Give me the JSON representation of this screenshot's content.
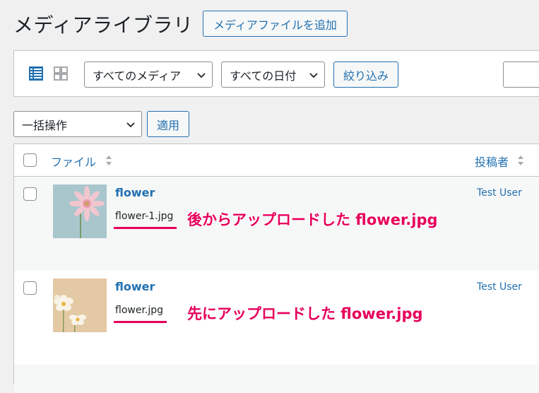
{
  "header": {
    "title": "メディアライブラリ",
    "add_button": "メディアファイルを追加"
  },
  "filters": {
    "media_type": "すべてのメディア",
    "date": "すべての日付",
    "filter_button": "絞り込み"
  },
  "bulk": {
    "action": "一括操作",
    "apply_button": "適用"
  },
  "table": {
    "columns": [
      "ファイル",
      "投稿者"
    ],
    "rows": [
      {
        "title": "flower",
        "filename": "flower-1.jpg",
        "annotation": "後からアップロードした flower.jpg",
        "author": "Test User"
      },
      {
        "title": "flower",
        "filename": "flower.jpg",
        "annotation": "先にアップロードした flower.jpg",
        "author": "Test User"
      }
    ]
  },
  "colors": {
    "accent": "#2271b1",
    "annotation": "#e6005c",
    "background": "#f0f0f1"
  },
  "icons": [
    "list-view-icon",
    "grid-view-icon",
    "chevron-down-icon",
    "sort-arrows-icon",
    "image-thumbnail"
  ]
}
